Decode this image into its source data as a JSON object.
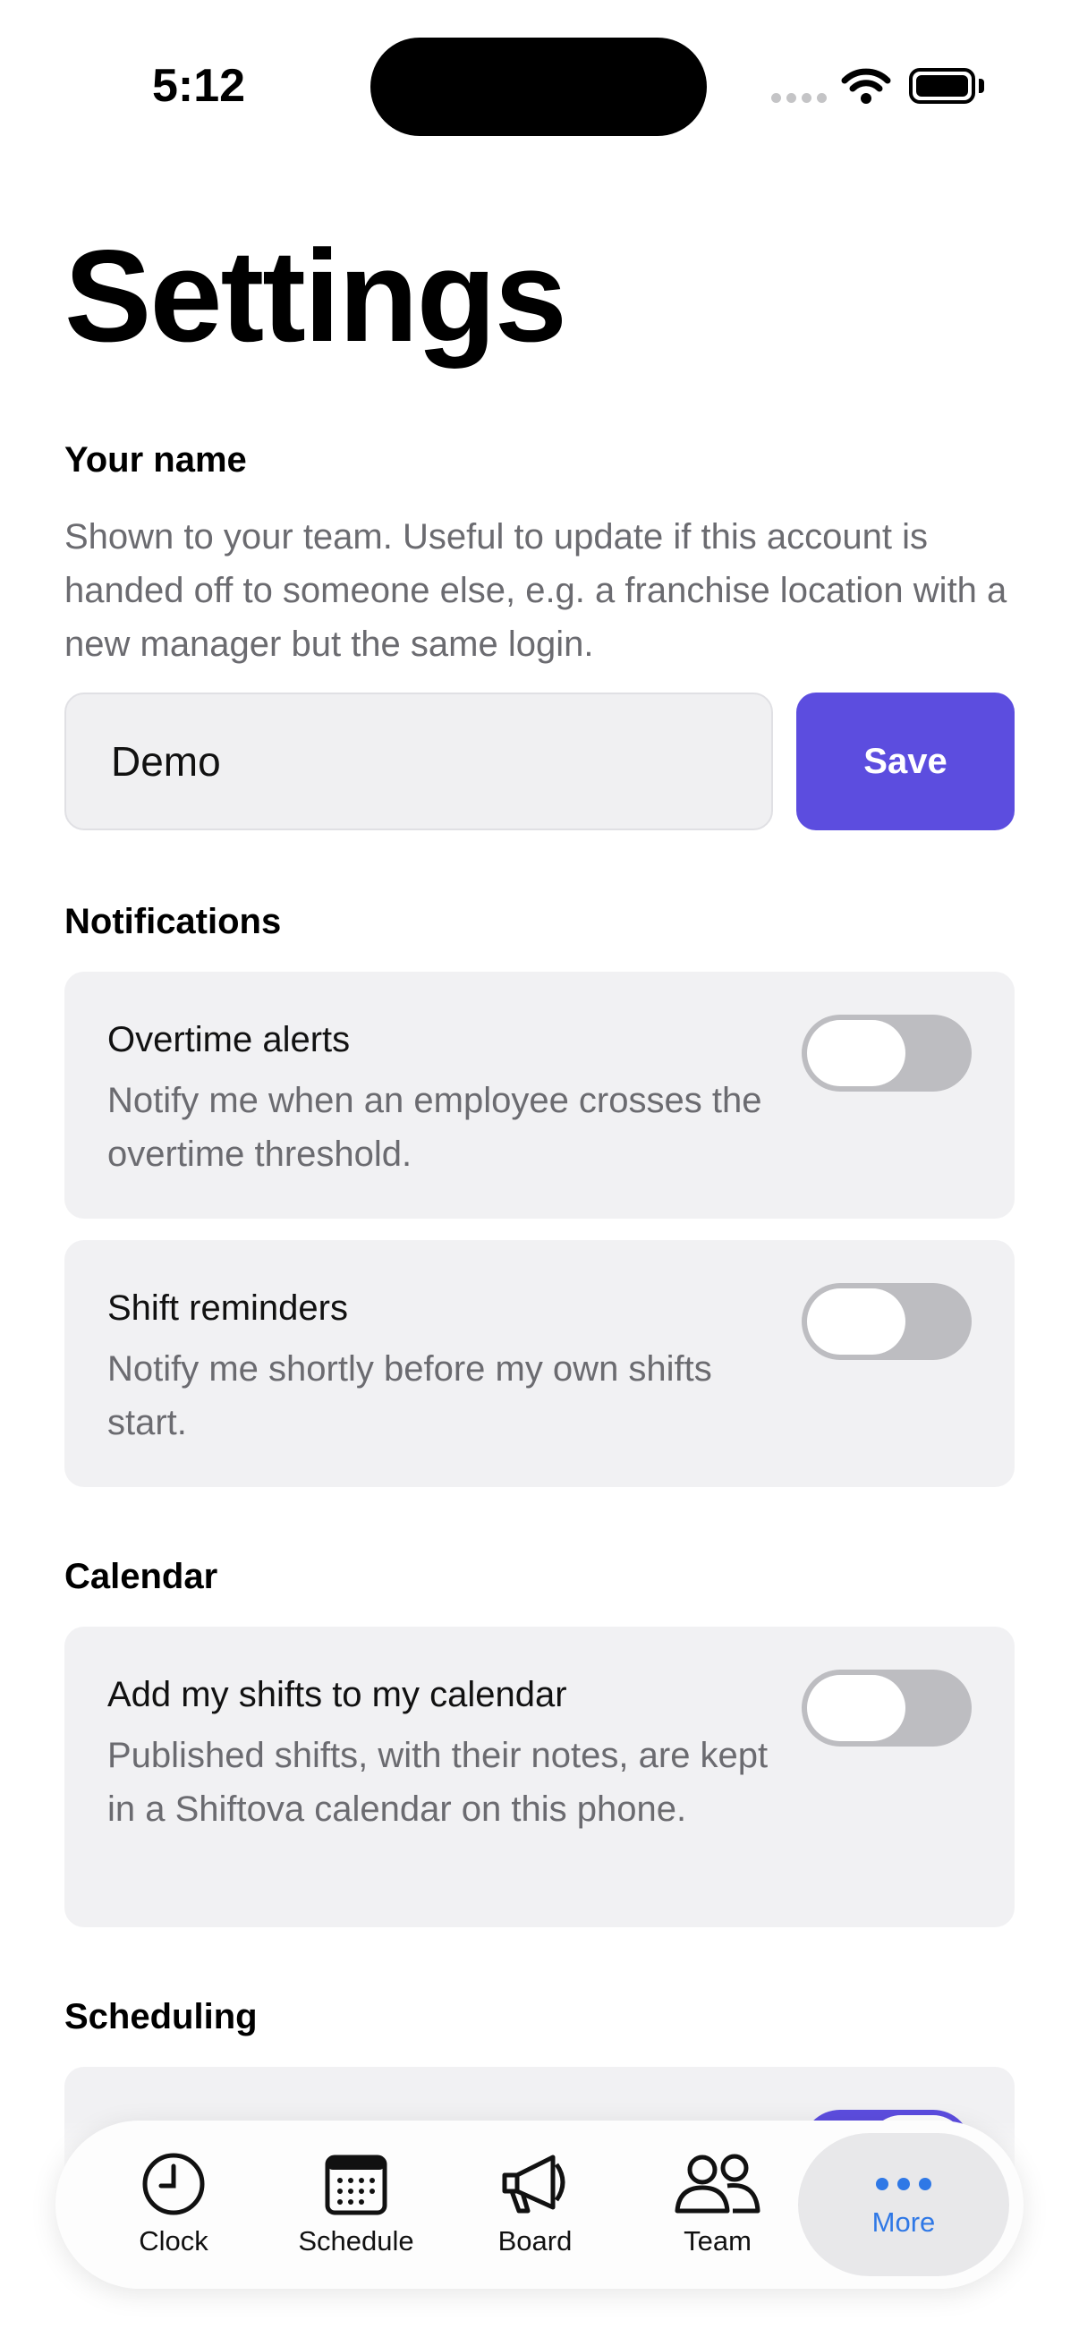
{
  "status_bar": {
    "time": "5:12"
  },
  "page": {
    "title": "Settings"
  },
  "your_name": {
    "label": "Your name",
    "description": "Shown to your team. Useful to update if this account is handed off to someone else, e.g. a franchise location with a new manager but the same login.",
    "input_value": "Demo",
    "save_label": "Save"
  },
  "notifications": {
    "label": "Notifications",
    "items": [
      {
        "title": "Overtime alerts",
        "description": "Notify me when an employee crosses the overtime threshold.",
        "enabled": false
      },
      {
        "title": "Shift reminders",
        "description": "Notify me shortly before my own shifts start.",
        "enabled": false
      }
    ]
  },
  "calendar": {
    "label": "Calendar",
    "items": [
      {
        "title": "Add my shifts to my calendar",
        "description": "Published shifts, with their notes, are kept in a Shiftova calendar on this phone.",
        "enabled": false
      }
    ]
  },
  "scheduling": {
    "label": "Scheduling",
    "items": [
      {
        "enabled": true
      }
    ]
  },
  "tabbar": {
    "tabs": [
      {
        "label": "Clock",
        "icon": "clock-icon",
        "active": false
      },
      {
        "label": "Schedule",
        "icon": "calendar-icon",
        "active": false
      },
      {
        "label": "Board",
        "icon": "megaphone-icon",
        "active": false
      },
      {
        "label": "Team",
        "icon": "people-icon",
        "active": false
      },
      {
        "label": "More",
        "icon": "ellipsis-icon",
        "active": true
      }
    ]
  },
  "colors": {
    "accent": "#5c4ddf",
    "tab_active": "#2f78e6",
    "card_bg": "#f1f1f3"
  }
}
